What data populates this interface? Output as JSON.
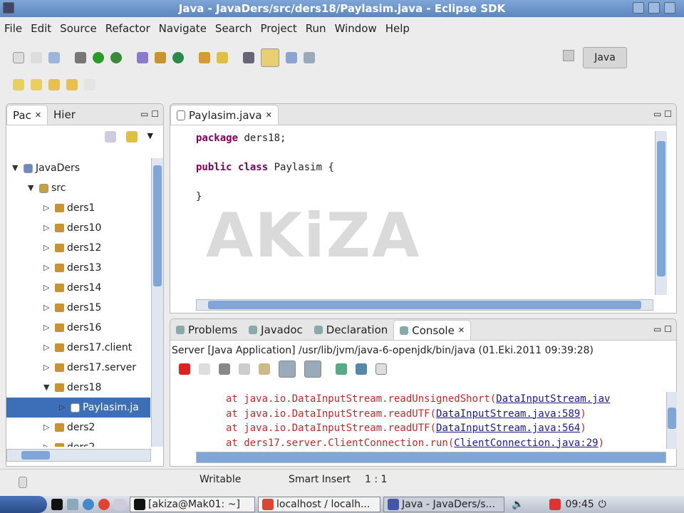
{
  "window": {
    "title": "Java - JavaDers/src/ders18/Paylasim.java - Eclipse SDK"
  },
  "menu": [
    "File",
    "Edit",
    "Source",
    "Refactor",
    "Navigate",
    "Search",
    "Project",
    "Run",
    "Window",
    "Help"
  ],
  "perspective": {
    "label": "Java"
  },
  "explorer": {
    "tabs": [
      "Pac",
      "Hier"
    ],
    "tree": [
      {
        "label": "JavaDers",
        "level": 0,
        "type": "project",
        "expanded": true
      },
      {
        "label": "src",
        "level": 1,
        "type": "folder",
        "expanded": true
      },
      {
        "label": "ders1",
        "level": 2,
        "type": "package"
      },
      {
        "label": "ders10",
        "level": 2,
        "type": "package"
      },
      {
        "label": "ders12",
        "level": 2,
        "type": "package"
      },
      {
        "label": "ders13",
        "level": 2,
        "type": "package"
      },
      {
        "label": "ders14",
        "level": 2,
        "type": "package"
      },
      {
        "label": "ders15",
        "level": 2,
        "type": "package"
      },
      {
        "label": "ders16",
        "level": 2,
        "type": "package"
      },
      {
        "label": "ders17.client",
        "level": 2,
        "type": "package"
      },
      {
        "label": "ders17.server",
        "level": 2,
        "type": "package"
      },
      {
        "label": "ders18",
        "level": 2,
        "type": "package",
        "expanded": true
      },
      {
        "label": "Paylasim.ja",
        "level": 3,
        "type": "file",
        "selected": true
      },
      {
        "label": "ders2",
        "level": 2,
        "type": "package"
      },
      {
        "label": "ders2",
        "level": 2,
        "type": "package"
      }
    ]
  },
  "editor": {
    "tab": "Paylasim.java",
    "lines": [
      [
        {
          "t": "package",
          "kw": true
        },
        {
          "t": " ders18;"
        }
      ],
      [],
      [
        {
          "t": "public",
          "kw": true
        },
        {
          "t": " "
        },
        {
          "t": "class",
          "kw": true
        },
        {
          "t": " Paylasim {"
        }
      ],
      [],
      [
        {
          "t": "}"
        }
      ]
    ],
    "watermark": "AKiZA"
  },
  "bottom": {
    "tabs": [
      "Problems",
      "Javadoc",
      "Declaration",
      "Console"
    ],
    "active": "Console",
    "header": "Server [Java Application] /usr/lib/jvm/java-6-openjdk/bin/java (01.Eki.2011 09:39:28)",
    "lines": [
      {
        "pre": "at java.io.DataInputStream.readUnsignedShort(",
        "link": "DataInputStream.jav",
        "post": ""
      },
      {
        "pre": "at java.io.DataInputStream.readUTF(",
        "link": "DataInputStream.java:589",
        "post": ")"
      },
      {
        "pre": "at java.io.DataInputStream.readUTF(",
        "link": "DataInputStream.java:564",
        "post": ")"
      },
      {
        "pre": "at ders17.server.ClientConnection.run(",
        "link": "ClientConnection.java:29",
        "post": ")"
      }
    ]
  },
  "status": {
    "writable": "Writable",
    "insert": "Smart Insert",
    "position": "1 : 1"
  },
  "taskbar": {
    "tasks": [
      "[akiza@Mak01: ~]",
      "localhost / localh...",
      "Java - JavaDers/s..."
    ],
    "clock": "09:45"
  }
}
